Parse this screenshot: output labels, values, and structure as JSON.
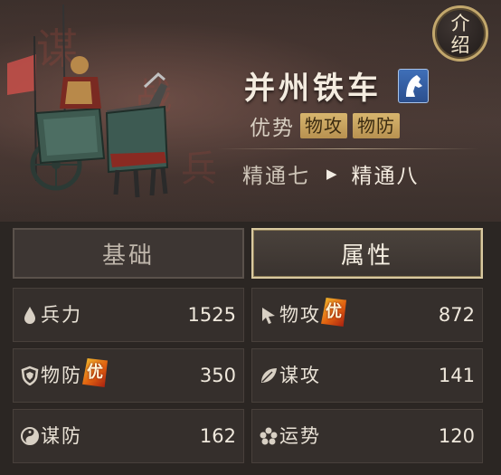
{
  "intro_button": {
    "line1": "介",
    "line2": "绍"
  },
  "unit": {
    "name": "并州铁车",
    "badge_icon": "horse-head-icon",
    "advantage_label": "优势",
    "advantage_tags": [
      "物攻",
      "物防"
    ]
  },
  "mastery": {
    "current": "精通七",
    "next": "精通八"
  },
  "tabs": [
    {
      "label": "基础",
      "active": false
    },
    {
      "label": "属性",
      "active": true
    }
  ],
  "stats": [
    {
      "icon": "drop-icon",
      "label": "兵力",
      "value": "1525",
      "advantage": false
    },
    {
      "icon": "cursor-icon",
      "label": "物攻",
      "value": "872",
      "advantage": true
    },
    {
      "icon": "shield-icon",
      "label": "物防",
      "value": "350",
      "advantage": true
    },
    {
      "icon": "leaf-icon",
      "label": "谋攻",
      "value": "141",
      "advantage": false
    },
    {
      "icon": "yin-yang-icon",
      "label": "谋防",
      "value": "162",
      "advantage": false
    },
    {
      "icon": "clover-icon",
      "label": "运势",
      "value": "120",
      "advantage": false
    }
  ],
  "advantage_mark": "优",
  "colors": {
    "gold": "#c2a76c",
    "active_border": "#d9c9a0",
    "badge_blue": "#3f6fb8"
  }
}
